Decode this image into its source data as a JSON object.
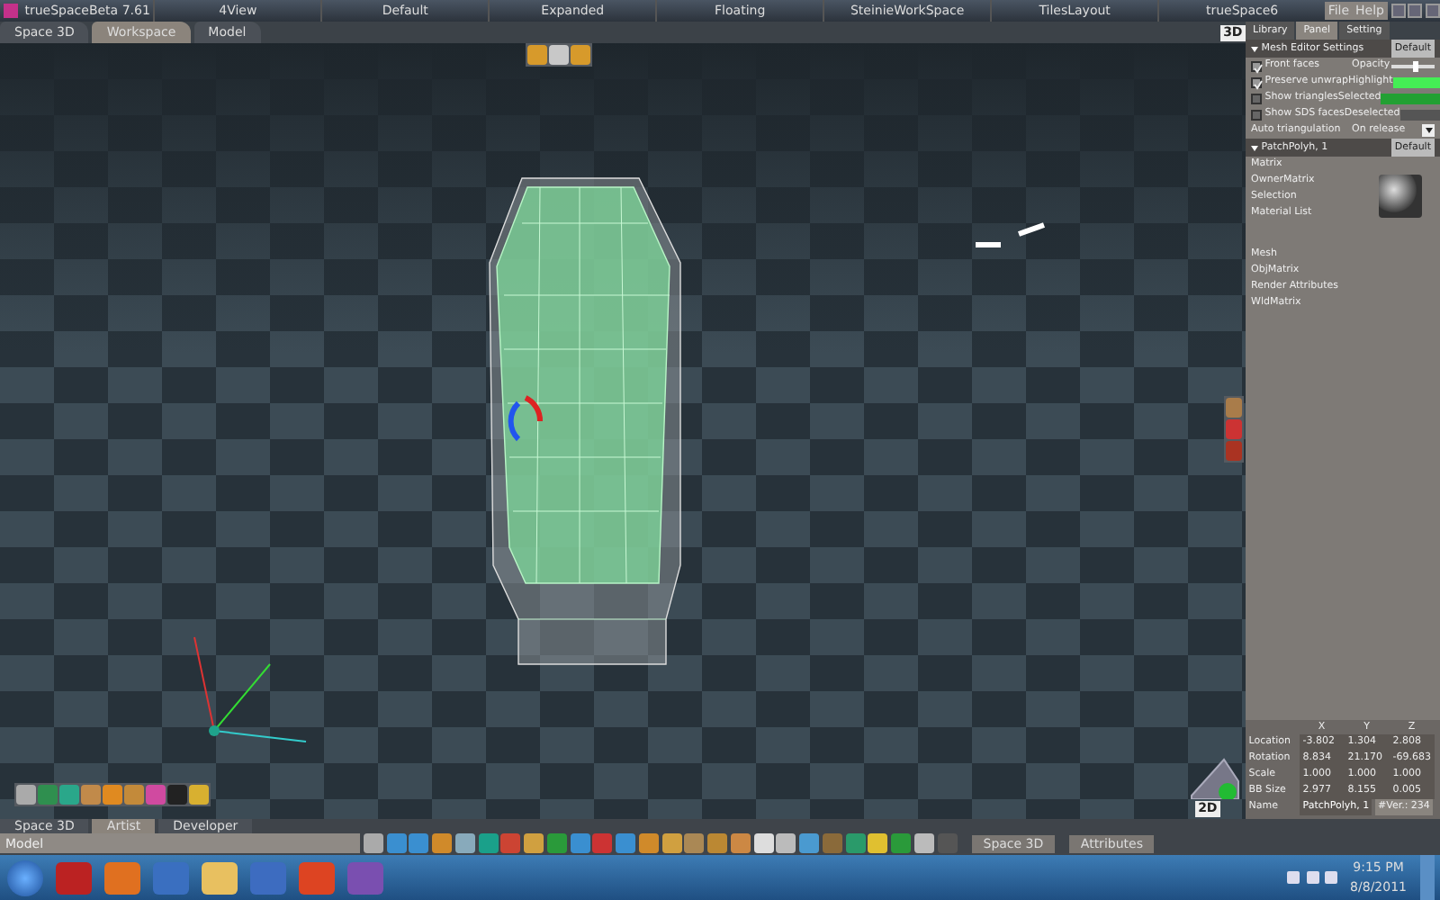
{
  "window": {
    "title": "trueSpaceBeta 7.61",
    "layouts": [
      {
        "label": "4View",
        "selected": false
      },
      {
        "label": "Default",
        "selected": false
      },
      {
        "label": "Expanded",
        "selected": false
      },
      {
        "label": "Floating",
        "selected": false
      },
      {
        "label": "SteinieWorkSpace",
        "selected": false
      },
      {
        "label": "TilesLayout",
        "selected": false
      },
      {
        "label": "trueSpace6",
        "selected": false
      }
    ],
    "menu": [
      "File",
      "Help"
    ]
  },
  "viewport": {
    "tabs": [
      {
        "label": "Space 3D",
        "selected": false
      },
      {
        "label": "Workspace",
        "selected": true
      },
      {
        "label": "Model",
        "selected": false
      }
    ],
    "view_label": "3D",
    "bottom_view_label": "2D"
  },
  "panel": {
    "tabs": [
      {
        "label": "Library",
        "selected": false
      },
      {
        "label": "Panel",
        "selected": true
      },
      {
        "label": "Setting",
        "selected": false
      }
    ],
    "mesh_editor": {
      "title": "Mesh Editor Settings",
      "preset": "Default",
      "options": [
        {
          "label": "Front faces",
          "checked": true
        },
        {
          "label": "Preserve unwrap",
          "checked": true
        },
        {
          "label": "Show triangles",
          "checked": false
        },
        {
          "label": "Show SDS faces",
          "checked": false
        }
      ],
      "settings": [
        {
          "kind": "slider",
          "label": "Opacity",
          "level": 0.55
        },
        {
          "kind": "color",
          "label": "Highlight",
          "color": "#44ee55"
        },
        {
          "kind": "color",
          "label": "Selected",
          "color": "#22a033"
        },
        {
          "kind": "color",
          "label": "Deselected",
          "color": "#555555"
        }
      ],
      "auto_triangulation": {
        "label": "Auto triangulation",
        "value": "On release"
      }
    },
    "object": {
      "title": "PatchPolyh, 1",
      "preset": "Default",
      "attributes": [
        "Matrix",
        "OwnerMatrix",
        "Selection",
        "Material List",
        "Mesh",
        "ObjMatrix",
        "Render Attributes",
        "WldMatrix"
      ]
    },
    "transform": {
      "columns": [
        "X",
        "Y",
        "Z"
      ],
      "rows": [
        {
          "label": "Location",
          "values": [
            "-3.802",
            "1.304",
            "2.808"
          ]
        },
        {
          "label": "Rotation",
          "values": [
            "8.834",
            "21.170",
            "-69.683"
          ]
        },
        {
          "label": "Scale",
          "values": [
            "1.000",
            "1.000",
            "1.000"
          ]
        },
        {
          "label": "BB Size",
          "values": [
            "2.977",
            "8.155",
            "0.005"
          ]
        }
      ],
      "name_label": "Name",
      "name": "PatchPolyh, 1",
      "vertices": "#Ver.: 234"
    }
  },
  "bottom": {
    "tabs": [
      {
        "label": "Space 3D",
        "selected": false
      },
      {
        "label": "Artist",
        "selected": true
      },
      {
        "label": "Developer",
        "selected": false
      }
    ],
    "field": "Model",
    "toolbar_labels": [
      "Space 3D",
      "Attributes"
    ]
  },
  "taskbar": {
    "time": "9:15 PM",
    "date": "8/8/2011"
  }
}
